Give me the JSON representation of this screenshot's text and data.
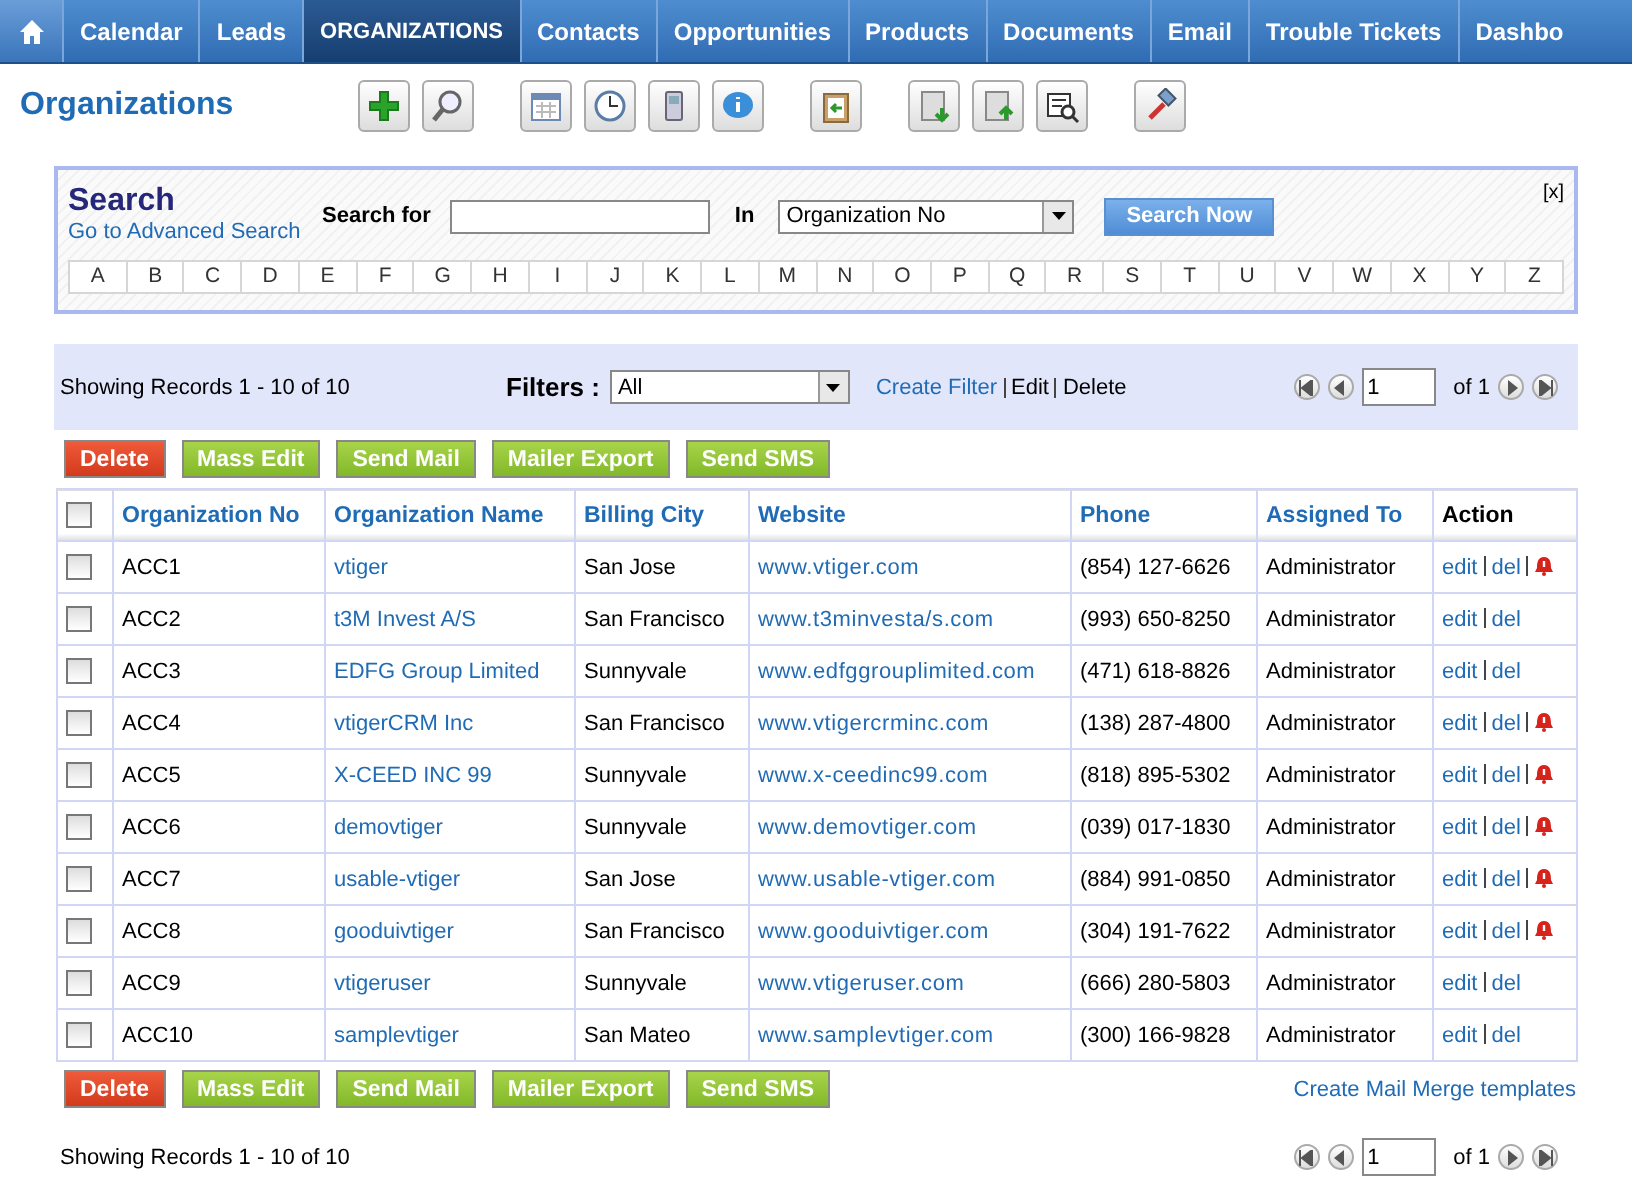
{
  "nav": [
    {
      "label": "Calendar",
      "selected": false
    },
    {
      "label": "Leads",
      "selected": false
    },
    {
      "label": "ORGANIZATIONS",
      "selected": true
    },
    {
      "label": "Contacts",
      "selected": false
    },
    {
      "label": "Opportunities",
      "selected": false
    },
    {
      "label": "Products",
      "selected": false
    },
    {
      "label": "Documents",
      "selected": false
    },
    {
      "label": "Email",
      "selected": false
    },
    {
      "label": "Trouble Tickets",
      "selected": false
    },
    {
      "label": "Dashbo",
      "selected": false
    }
  ],
  "page_title": "Organizations",
  "search": {
    "title": "Search",
    "advanced_link": "Go to Advanced Search",
    "search_for_label": "Search for",
    "in_label": "In",
    "field": "Organization No",
    "button": "Search Now",
    "close": "[x]",
    "letters": [
      "A",
      "B",
      "C",
      "D",
      "E",
      "F",
      "G",
      "H",
      "I",
      "J",
      "K",
      "L",
      "M",
      "N",
      "O",
      "P",
      "Q",
      "R",
      "S",
      "T",
      "U",
      "V",
      "W",
      "X",
      "Y",
      "Z"
    ]
  },
  "filter_bar": {
    "records": "Showing Records 1 - 10 of 10",
    "filters_label": "Filters :",
    "filter_value": "All",
    "create_filter": "Create Filter",
    "edit": "Edit",
    "delete": "Delete",
    "page": "1",
    "of": "of 1"
  },
  "actions": [
    {
      "label": "Delete",
      "kind": "danger"
    },
    {
      "label": "Mass Edit",
      "kind": "normal"
    },
    {
      "label": "Send Mail",
      "kind": "normal"
    },
    {
      "label": "Mailer Export",
      "kind": "normal"
    },
    {
      "label": "Send SMS",
      "kind": "normal"
    }
  ],
  "table": {
    "select_all_checked": false,
    "columns": [
      "Organization No",
      "Organization Name",
      "Billing City",
      "Website",
      "Phone",
      "Assigned To",
      "Action"
    ],
    "rows": [
      {
        "no": "ACC1",
        "name": "vtiger",
        "city": "San Jose",
        "website": "www.vtiger.com",
        "phone": "(854) 127-6626",
        "assigned": "Administrator",
        "edit": "edit",
        "del": "del",
        "alert": true,
        "checked": false
      },
      {
        "no": "ACC2",
        "name": "t3M Invest A/S",
        "city": "San Francisco",
        "website": "www.t3minvesta/s.com",
        "phone": "(993) 650-8250",
        "assigned": "Administrator",
        "edit": "edit",
        "del": "del",
        "alert": false,
        "checked": false
      },
      {
        "no": "ACC3",
        "name": "EDFG Group Limited",
        "city": "Sunnyvale",
        "website": "www.edfggrouplimited.com",
        "phone": "(471) 618-8826",
        "assigned": "Administrator",
        "edit": "edit",
        "del": "del",
        "alert": false,
        "checked": false
      },
      {
        "no": "ACC4",
        "name": "vtigerCRM Inc",
        "city": "San Francisco",
        "website": "www.vtigercrminc.com",
        "phone": "(138) 287-4800",
        "assigned": "Administrator",
        "edit": "edit",
        "del": "del",
        "alert": true,
        "checked": false
      },
      {
        "no": "ACC5",
        "name": "X-CEED INC 99",
        "city": "Sunnyvale",
        "website": "www.x-ceedinc99.com",
        "phone": "(818) 895-5302",
        "assigned": "Administrator",
        "edit": "edit",
        "del": "del",
        "alert": true,
        "checked": false
      },
      {
        "no": "ACC6",
        "name": "demovtiger",
        "city": "Sunnyvale",
        "website": "www.demovtiger.com",
        "phone": "(039) 017-1830",
        "assigned": "Administrator",
        "edit": "edit",
        "del": "del",
        "alert": true,
        "checked": false
      },
      {
        "no": "ACC7",
        "name": "usable-vtiger",
        "city": "San Jose",
        "website": "www.usable-vtiger.com",
        "phone": "(884) 991-0850",
        "assigned": "Administrator",
        "edit": "edit",
        "del": "del",
        "alert": true,
        "checked": false
      },
      {
        "no": "ACC8",
        "name": "gooduivtiger",
        "city": "San Francisco",
        "website": "www.gooduivtiger.com",
        "phone": "(304) 191-7622",
        "assigned": "Administrator",
        "edit": "edit",
        "del": "del",
        "alert": true,
        "checked": false
      },
      {
        "no": "ACC9",
        "name": "vtigeruser",
        "city": "Sunnyvale",
        "website": "www.vtigeruser.com",
        "phone": "(666) 280-5803",
        "assigned": "Administrator",
        "edit": "edit",
        "del": "del",
        "alert": false,
        "checked": false
      },
      {
        "no": "ACC10",
        "name": "samplevtiger",
        "city": "San Mateo",
        "website": "www.samplevtiger.com",
        "phone": "(300) 166-9828",
        "assigned": "Administrator",
        "edit": "edit",
        "del": "del",
        "alert": false,
        "checked": false
      }
    ]
  },
  "bottom_actions": [
    {
      "label": "Delete",
      "kind": "danger"
    },
    {
      "label": "Mass Edit",
      "kind": "normal"
    },
    {
      "label": "Send Mail",
      "kind": "normal"
    },
    {
      "label": "Mailer Export",
      "kind": "normal"
    },
    {
      "label": "Send SMS",
      "kind": "normal"
    }
  ],
  "mail_merge_link": "Create Mail Merge templates",
  "footer": {
    "records": "Showing Records 1 - 10 of 10",
    "page": "1",
    "of": "of 1"
  }
}
